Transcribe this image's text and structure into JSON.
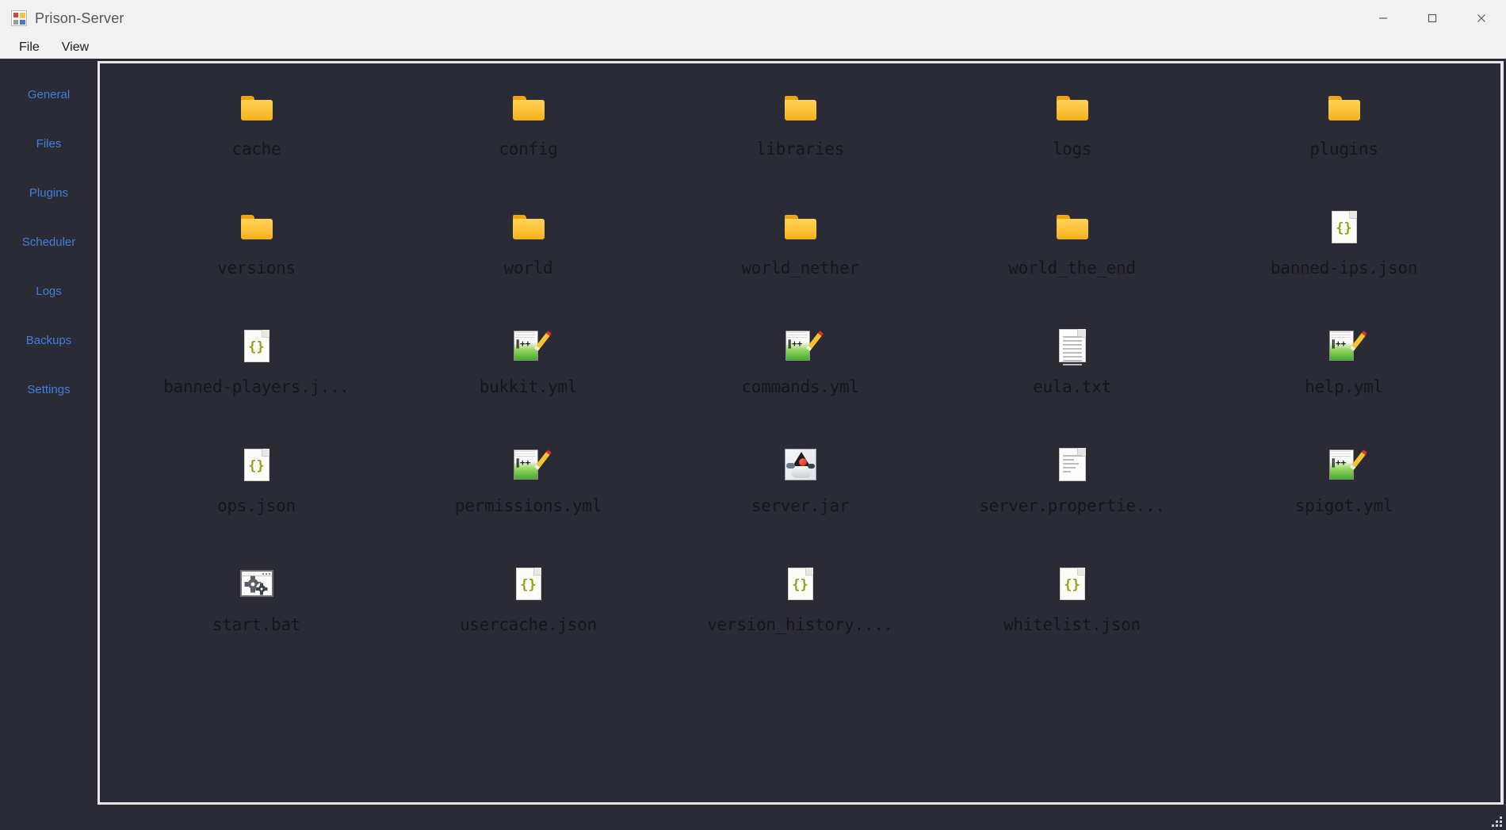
{
  "window": {
    "title": "Prison-Server",
    "app_icon": "app-window-icon",
    "controls": {
      "minimize": "minimize-icon",
      "maximize": "maximize-icon",
      "close": "close-icon"
    }
  },
  "menubar": {
    "items": [
      {
        "label": "File",
        "name": "menu-file"
      },
      {
        "label": "View",
        "name": "menu-view"
      }
    ]
  },
  "sidebar": {
    "items": [
      {
        "label": "General",
        "name": "sidebar-item-general"
      },
      {
        "label": "Files",
        "name": "sidebar-item-files"
      },
      {
        "label": "Plugins",
        "name": "sidebar-item-plugins"
      },
      {
        "label": "Scheduler",
        "name": "sidebar-item-scheduler"
      },
      {
        "label": "Logs",
        "name": "sidebar-item-logs"
      },
      {
        "label": "Backups",
        "name": "sidebar-item-backups"
      },
      {
        "label": "Settings",
        "name": "sidebar-item-settings"
      }
    ],
    "link_color": "#3f7fe0"
  },
  "colors": {
    "window_chrome": "#f1f1f1",
    "dark_background": "#2b2b35",
    "panel_border": "#e8e8ea",
    "folder_yellow": "#fbc238",
    "label_text": "#15151c",
    "json_brace": "#9b9b1e"
  },
  "file_browser": {
    "items": [
      {
        "label": "cache",
        "icon": "folder-icon",
        "type": "folder"
      },
      {
        "label": "config",
        "icon": "folder-icon",
        "type": "folder"
      },
      {
        "label": "libraries",
        "icon": "folder-icon",
        "type": "folder"
      },
      {
        "label": "logs",
        "icon": "folder-icon",
        "type": "folder"
      },
      {
        "label": "plugins",
        "icon": "folder-icon",
        "type": "folder"
      },
      {
        "label": "versions",
        "icon": "folder-icon",
        "type": "folder"
      },
      {
        "label": "world",
        "icon": "folder-icon",
        "type": "folder"
      },
      {
        "label": "world_nether",
        "icon": "folder-icon",
        "type": "folder"
      },
      {
        "label": "world_the_end",
        "icon": "folder-icon",
        "type": "folder"
      },
      {
        "label": "banned-ips.json",
        "icon": "json-file-icon",
        "type": "json"
      },
      {
        "label": "banned-players.j...",
        "icon": "json-file-icon",
        "type": "json"
      },
      {
        "label": "bukkit.yml",
        "icon": "notepad-plus-plus-icon",
        "type": "npp"
      },
      {
        "label": "commands.yml",
        "icon": "notepad-plus-plus-icon",
        "type": "npp"
      },
      {
        "label": "eula.txt",
        "icon": "text-document-icon",
        "type": "doc"
      },
      {
        "label": "help.yml",
        "icon": "notepad-plus-plus-icon",
        "type": "npp"
      },
      {
        "label": "ops.json",
        "icon": "json-file-icon",
        "type": "json"
      },
      {
        "label": "permissions.yml",
        "icon": "notepad-plus-plus-icon",
        "type": "npp"
      },
      {
        "label": "server.jar",
        "icon": "java-archive-icon",
        "type": "jar"
      },
      {
        "label": "server.propertie...",
        "icon": "properties-document-icon",
        "type": "doc-sparse"
      },
      {
        "label": "spigot.yml",
        "icon": "notepad-plus-plus-icon",
        "type": "npp"
      },
      {
        "label": "start.bat",
        "icon": "batch-script-icon",
        "type": "bat"
      },
      {
        "label": "usercache.json",
        "icon": "json-file-icon",
        "type": "json"
      },
      {
        "label": "version_history....",
        "icon": "json-file-icon",
        "type": "json"
      },
      {
        "label": "whitelist.json",
        "icon": "json-file-icon",
        "type": "json"
      }
    ]
  }
}
